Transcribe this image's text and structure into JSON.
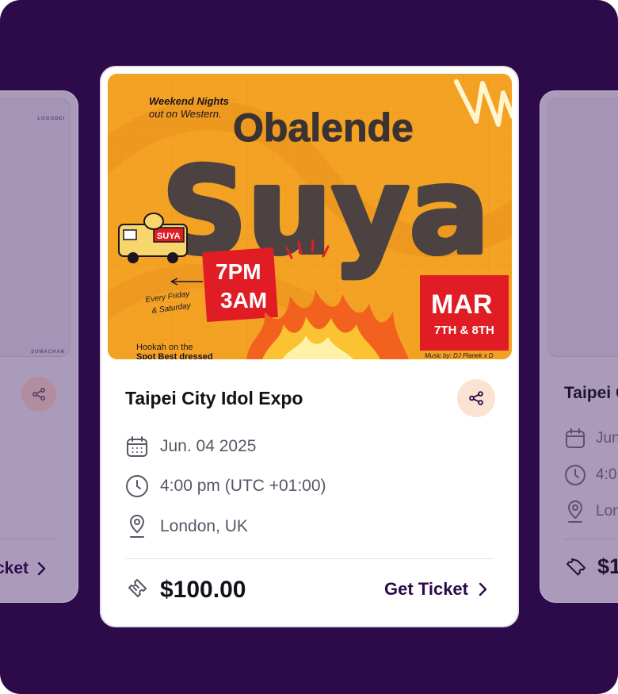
{
  "main_card": {
    "poster": {
      "tagline_line1": "Weekend Nights",
      "tagline_line2": "out on Western.",
      "brand": "Obalende",
      "headline": "Suya",
      "time_start": "7PM",
      "time_end": "3AM",
      "days_line1": "Every Friday",
      "days_line2": "& Saturday",
      "month": "MAR",
      "dates": "7TH & 8TH",
      "footer_left_line1": "Hookah on the",
      "footer_left_line2": "Spot Best dressed",
      "music_credit": "Music by: DJ Planek x D",
      "van_sign": "SUYA"
    },
    "title": "Taipei City Idol Expo",
    "date": "Jun. 04 2025",
    "time": "4:00 pm (UTC +01:00)",
    "location": "London, UK",
    "price": "$100.00",
    "cta": "Get Ticket"
  },
  "left_card": {
    "poster_logo_top": "LOGODEI",
    "poster_logo_bottom": "SUMACHAN",
    "cta": "cket"
  },
  "right_card": {
    "title": "Taipei C",
    "date": "Jun",
    "time": "4:0",
    "location": "Lon",
    "price": "$1"
  },
  "icons": {
    "share": "share-icon",
    "calendar": "calendar-icon",
    "clock": "clock-icon",
    "location": "location-pin-icon",
    "ticket": "ticket-icon",
    "chevron": "chevron-right-icon"
  },
  "colors": {
    "background": "#2d0a4a",
    "accent": "#2d0a4a",
    "share_bg": "#fbe3d3",
    "poster_orange": "#f4a224",
    "poster_red": "#e01d25"
  }
}
